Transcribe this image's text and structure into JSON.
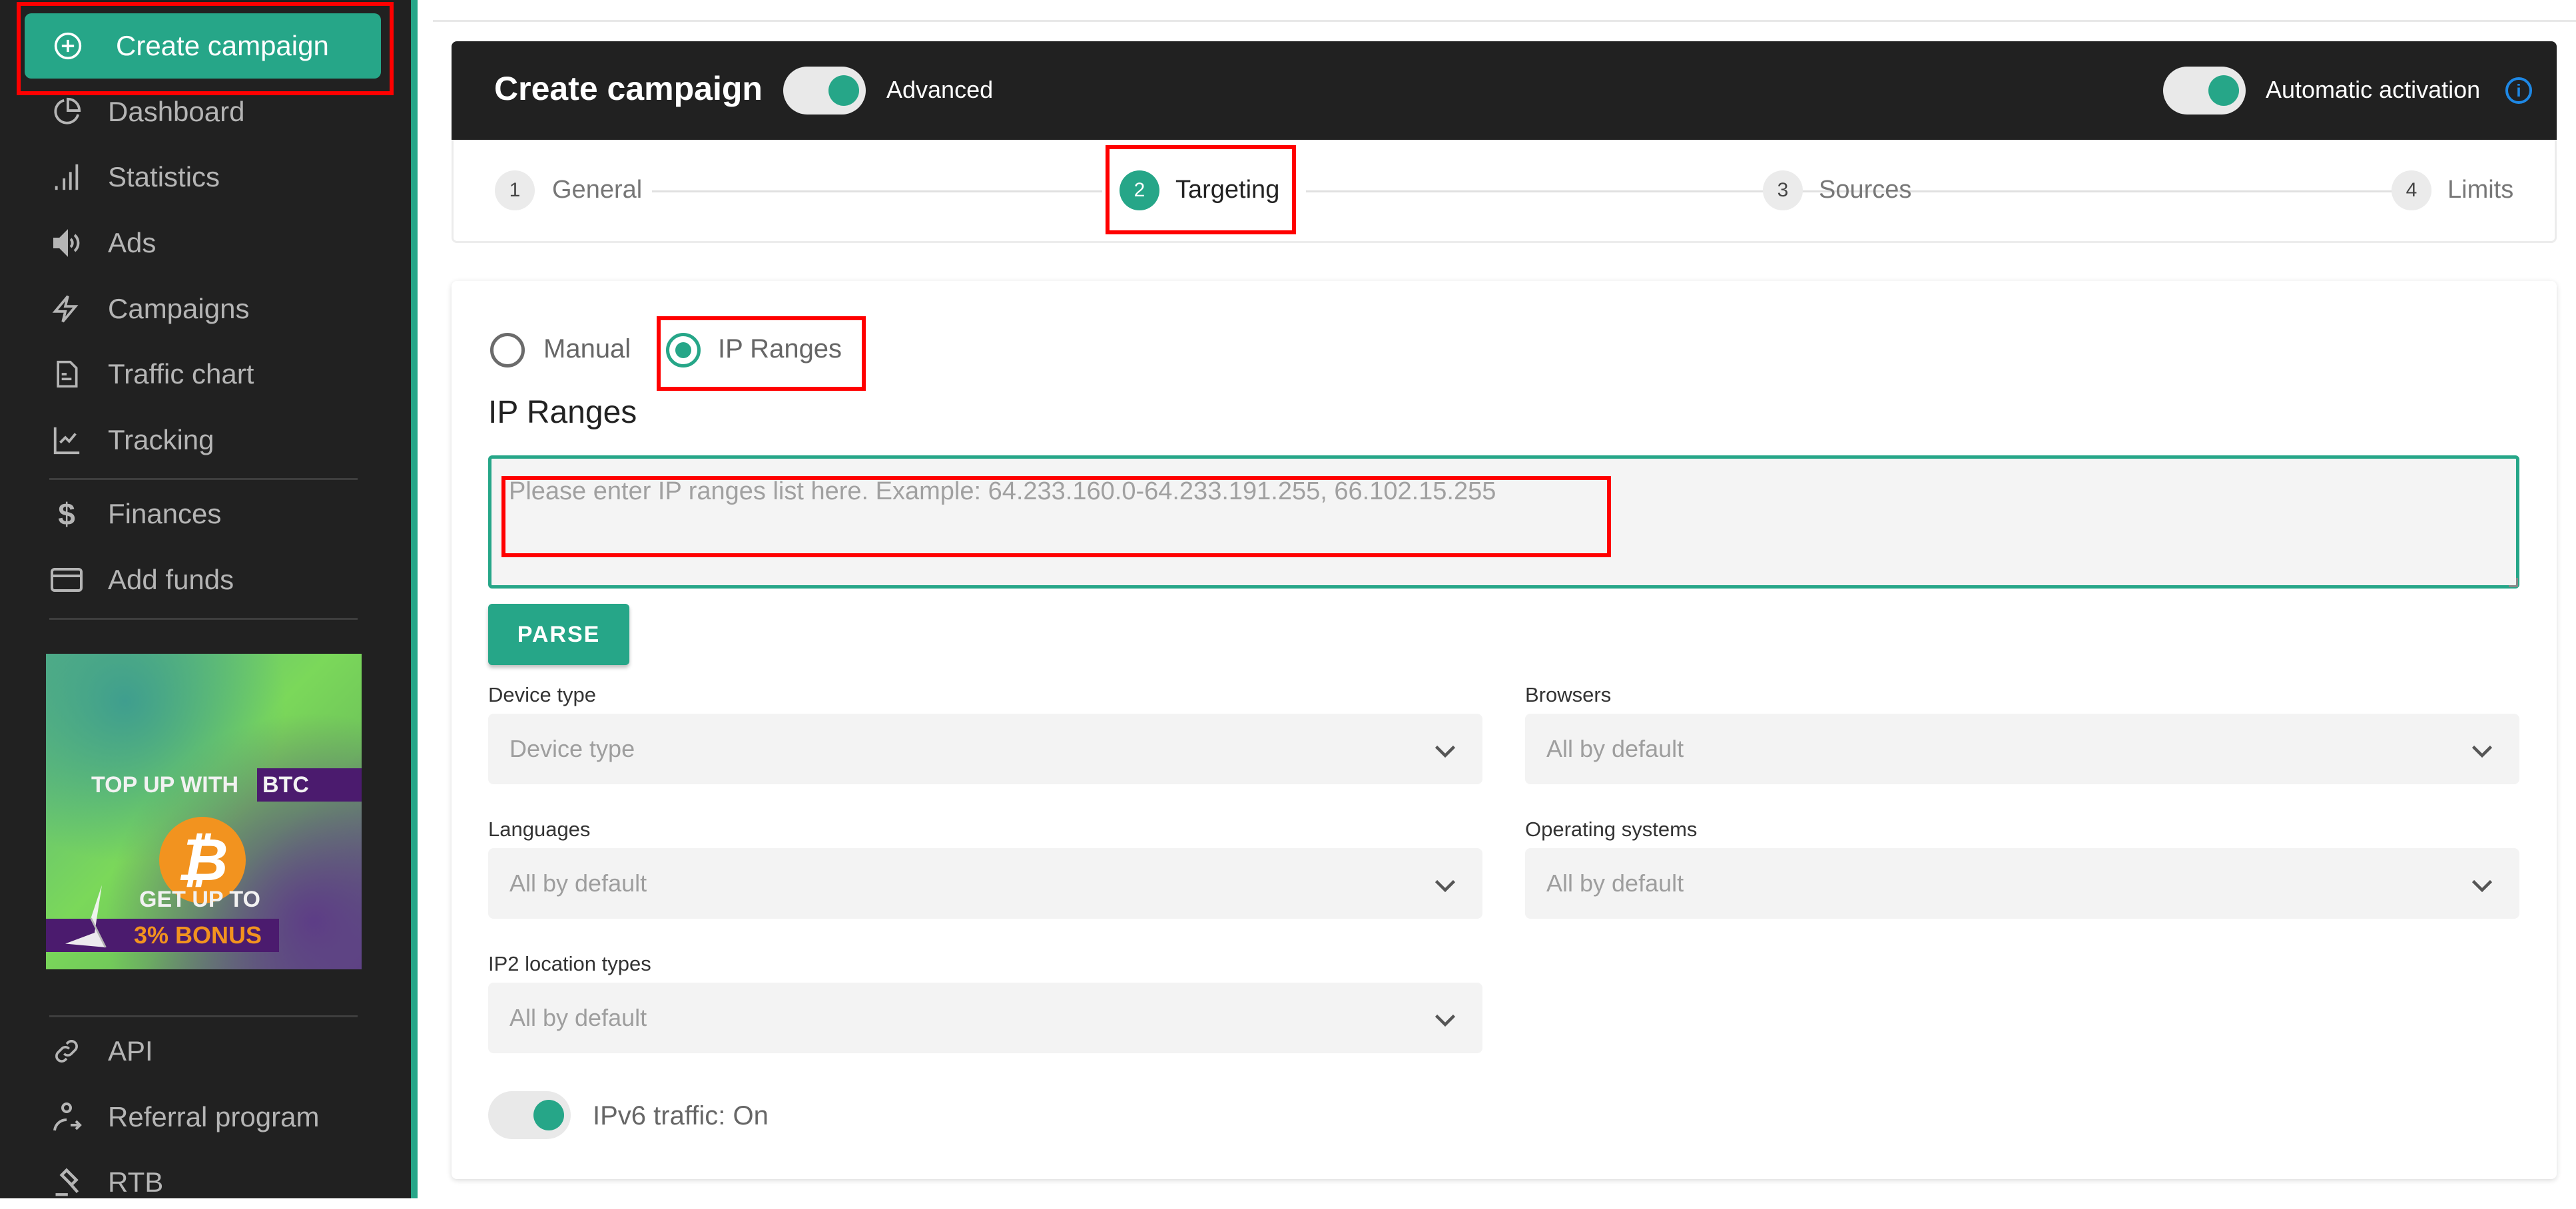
{
  "sidebar": {
    "create_button": {
      "label": "Create campaign",
      "icon": "plus-circle-icon"
    },
    "items": [
      {
        "label": "Dashboard",
        "icon": "pie-chart-icon"
      },
      {
        "label": "Statistics",
        "icon": "bar-signal-icon"
      },
      {
        "label": "Ads",
        "icon": "speaker-icon"
      },
      {
        "label": "Campaigns",
        "icon": "lightning-icon"
      },
      {
        "label": "Traffic chart",
        "icon": "document-icon"
      },
      {
        "label": "Tracking",
        "icon": "line-chart-icon"
      },
      {
        "label": "Finances",
        "icon": "dollar-icon"
      },
      {
        "label": "Add funds",
        "icon": "credit-card-icon"
      },
      {
        "label": "API",
        "icon": "link-icon"
      },
      {
        "label": "Referral program",
        "icon": "user-share-icon"
      },
      {
        "label": "RTB",
        "icon": "gavel-icon"
      }
    ],
    "banner": {
      "line1": "TOP UP WITH",
      "line1_highlight": "BTC",
      "coin_symbol": "₿",
      "line2": "GET UP TO",
      "line3": "3% BONUS"
    }
  },
  "header": {
    "title": "Create campaign",
    "advanced_toggle": {
      "label": "Advanced",
      "on": true
    },
    "auto_activation_toggle": {
      "label": "Automatic activation",
      "on": true
    },
    "info_icon": "i"
  },
  "stepper": {
    "steps": [
      {
        "number": "1",
        "label": "General",
        "active": false
      },
      {
        "number": "2",
        "label": "Targeting",
        "active": true
      },
      {
        "number": "3",
        "label": "Sources",
        "active": false
      },
      {
        "number": "4",
        "label": "Limits",
        "active": false
      }
    ]
  },
  "targeting": {
    "mode_options": [
      {
        "label": "Manual",
        "checked": false
      },
      {
        "label": "IP Ranges",
        "checked": true
      }
    ],
    "section_title": "IP Ranges",
    "ip_input": {
      "value": "",
      "placeholder": "Please enter IP ranges list here. Example: 64.233.160.0-64.233.191.255, 66.102.15.255"
    },
    "parse_button": "PARSE",
    "fields": {
      "device_type": {
        "label": "Device type",
        "value": "Device type"
      },
      "browsers": {
        "label": "Browsers",
        "value": "All by default"
      },
      "languages": {
        "label": "Languages",
        "value": "All by default"
      },
      "operating_systems": {
        "label": "Operating systems",
        "value": "All by default"
      },
      "ip2_location_types": {
        "label": "IP2 location types",
        "value": "All by default"
      }
    },
    "ipv6_toggle": {
      "label": "IPv6 traffic: On",
      "on": true
    }
  },
  "colors": {
    "accent": "#26a688",
    "sidebar_bg": "#212121",
    "header_bg": "#212121",
    "highlight": "#ff0000",
    "info": "#1e88e5"
  }
}
